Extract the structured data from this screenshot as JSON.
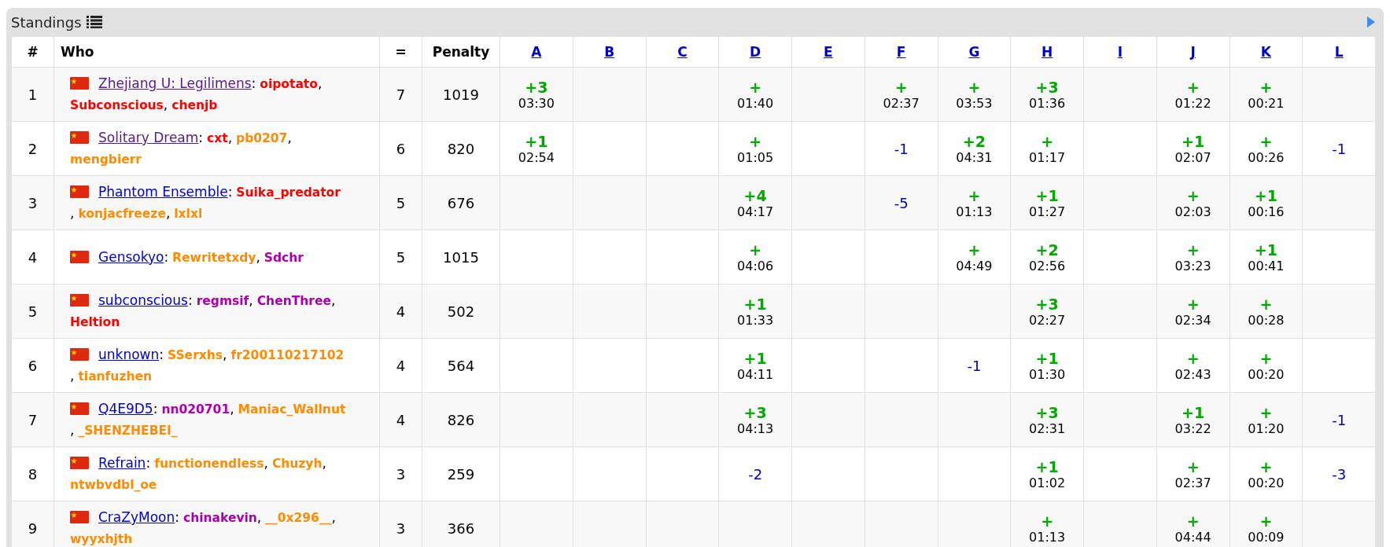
{
  "panel": {
    "title": "Standings"
  },
  "columns": {
    "rank": "#",
    "who": "Who",
    "solved": "=",
    "penalty": "Penalty",
    "problems": [
      "A",
      "B",
      "C",
      "D",
      "E",
      "F",
      "G",
      "H",
      "I",
      "J",
      "K",
      "L"
    ]
  },
  "rows": [
    {
      "rank": "1",
      "team": {
        "name": "Zhejiang U: Legilimens",
        "color": "#551a8b",
        "sep": ":"
      },
      "members": [
        {
          "name": "oipotato",
          "color": "#ff0000",
          "sep": ","
        },
        {
          "name": "Subconscious",
          "color": "#ff0000",
          "sep": ","
        },
        {
          "name": "chenjb",
          "color": "#ff0000"
        }
      ],
      "solved": "7",
      "penalty": "1019",
      "cells": [
        {
          "kind": "accepted",
          "score": "+3",
          "time": "03:30"
        },
        {
          "kind": "empty"
        },
        {
          "kind": "empty"
        },
        {
          "kind": "accepted",
          "score": "+",
          "time": "01:40"
        },
        {
          "kind": "empty"
        },
        {
          "kind": "accepted",
          "score": "+",
          "time": "02:37"
        },
        {
          "kind": "accepted",
          "score": "+",
          "time": "03:53"
        },
        {
          "kind": "accepted",
          "score": "+3",
          "time": "01:36"
        },
        {
          "kind": "empty"
        },
        {
          "kind": "accepted",
          "score": "+",
          "time": "01:22"
        },
        {
          "kind": "accepted",
          "score": "+",
          "time": "00:21"
        },
        {
          "kind": "empty"
        }
      ]
    },
    {
      "rank": "2",
      "team": {
        "name": "Solitary Dream",
        "color": "#551a8b",
        "sep": ":"
      },
      "members": [
        {
          "name": "cxt",
          "color": "#ff0000",
          "sep": ","
        },
        {
          "name": "pb0207",
          "color": "#ff8c00",
          "sep": ","
        },
        {
          "name": "mengbierr",
          "color": "#ff8c00"
        }
      ],
      "solved": "6",
      "penalty": "820",
      "cells": [
        {
          "kind": "accepted",
          "score": "+1",
          "time": "02:54"
        },
        {
          "kind": "empty"
        },
        {
          "kind": "empty"
        },
        {
          "kind": "accepted",
          "score": "+",
          "time": "01:05"
        },
        {
          "kind": "empty"
        },
        {
          "kind": "rejected",
          "score": "-1"
        },
        {
          "kind": "accepted",
          "score": "+2",
          "time": "04:31"
        },
        {
          "kind": "accepted",
          "score": "+",
          "time": "01:17"
        },
        {
          "kind": "empty"
        },
        {
          "kind": "accepted",
          "score": "+1",
          "time": "02:07"
        },
        {
          "kind": "accepted",
          "score": "+",
          "time": "00:26"
        },
        {
          "kind": "rejected",
          "score": "-1"
        }
      ]
    },
    {
      "rank": "3",
      "team": {
        "name": "Phantom Ensemble",
        "color": "#0000cc",
        "sep": ":"
      },
      "members": [
        {
          "name": "Suika_predator",
          "color": "#ff0000",
          "sep": ","
        },
        {
          "name": "konjacfreeze",
          "color": "#ff8c00",
          "sep": ","
        },
        {
          "name": "lxlxl",
          "color": "#ff8c00"
        }
      ],
      "solved": "5",
      "penalty": "676",
      "cells": [
        {
          "kind": "empty"
        },
        {
          "kind": "empty"
        },
        {
          "kind": "empty"
        },
        {
          "kind": "accepted",
          "score": "+4",
          "time": "04:17"
        },
        {
          "kind": "empty"
        },
        {
          "kind": "rejected",
          "score": "-5"
        },
        {
          "kind": "accepted",
          "score": "+",
          "time": "01:13"
        },
        {
          "kind": "accepted",
          "score": "+1",
          "time": "01:27"
        },
        {
          "kind": "empty"
        },
        {
          "kind": "accepted",
          "score": "+",
          "time": "02:03"
        },
        {
          "kind": "accepted",
          "score": "+1",
          "time": "00:16"
        },
        {
          "kind": "empty"
        }
      ]
    },
    {
      "rank": "4",
      "team": {
        "name": "Gensokyo",
        "color": "#0000cc",
        "sep": ":"
      },
      "members": [
        {
          "name": "Rewritetxdy",
          "color": "#ff8c00",
          "sep": ","
        },
        {
          "name": "Sdchr",
          "color": "#aa00aa"
        }
      ],
      "solved": "5",
      "penalty": "1015",
      "cells": [
        {
          "kind": "empty"
        },
        {
          "kind": "empty"
        },
        {
          "kind": "empty"
        },
        {
          "kind": "accepted",
          "score": "+",
          "time": "04:06"
        },
        {
          "kind": "empty"
        },
        {
          "kind": "empty"
        },
        {
          "kind": "accepted",
          "score": "+",
          "time": "04:49"
        },
        {
          "kind": "accepted",
          "score": "+2",
          "time": "02:56"
        },
        {
          "kind": "empty"
        },
        {
          "kind": "accepted",
          "score": "+",
          "time": "03:23"
        },
        {
          "kind": "accepted",
          "score": "+1",
          "time": "00:41"
        },
        {
          "kind": "empty"
        }
      ]
    },
    {
      "rank": "5",
      "team": {
        "name": "subconscious",
        "color": "#0000cc",
        "sep": ":"
      },
      "members": [
        {
          "name": "regmsif",
          "color": "#aa00aa",
          "sep": ","
        },
        {
          "name": "ChenThree",
          "color": "#aa00aa",
          "sep": ","
        },
        {
          "name": "Heltion",
          "color": "#ff0000"
        }
      ],
      "solved": "4",
      "penalty": "502",
      "cells": [
        {
          "kind": "empty"
        },
        {
          "kind": "empty"
        },
        {
          "kind": "empty"
        },
        {
          "kind": "accepted",
          "score": "+1",
          "time": "01:33"
        },
        {
          "kind": "empty"
        },
        {
          "kind": "empty"
        },
        {
          "kind": "empty"
        },
        {
          "kind": "accepted",
          "score": "+3",
          "time": "02:27"
        },
        {
          "kind": "empty"
        },
        {
          "kind": "accepted",
          "score": "+",
          "time": "02:34"
        },
        {
          "kind": "accepted",
          "score": "+",
          "time": "00:28"
        },
        {
          "kind": "empty"
        }
      ]
    },
    {
      "rank": "6",
      "team": {
        "name": "unknown",
        "color": "#0000cc",
        "sep": ":"
      },
      "members": [
        {
          "name": "SSerxhs",
          "color": "#ff8c00",
          "sep": ","
        },
        {
          "name": "fr200110217102",
          "color": "#ff8c00",
          "sep": ","
        },
        {
          "name": "tianfuzhen",
          "color": "#ff8c00"
        }
      ],
      "solved": "4",
      "penalty": "564",
      "cells": [
        {
          "kind": "empty"
        },
        {
          "kind": "empty"
        },
        {
          "kind": "empty"
        },
        {
          "kind": "accepted",
          "score": "+1",
          "time": "04:11"
        },
        {
          "kind": "empty"
        },
        {
          "kind": "empty"
        },
        {
          "kind": "rejected",
          "score": "-1"
        },
        {
          "kind": "accepted",
          "score": "+1",
          "time": "01:30"
        },
        {
          "kind": "empty"
        },
        {
          "kind": "accepted",
          "score": "+",
          "time": "02:43"
        },
        {
          "kind": "accepted",
          "score": "+",
          "time": "00:20"
        },
        {
          "kind": "empty"
        }
      ]
    },
    {
      "rank": "7",
      "team": {
        "name": "Q4E9D5",
        "color": "#0000cc",
        "sep": ":"
      },
      "members": [
        {
          "name": "nn020701",
          "color": "#aa00aa",
          "sep": ","
        },
        {
          "name": "Maniac_Wallnut",
          "color": "#ff8c00",
          "sep": ","
        },
        {
          "name": "_SHENZHEBEI_",
          "color": "#ff8c00"
        }
      ],
      "solved": "4",
      "penalty": "826",
      "cells": [
        {
          "kind": "empty"
        },
        {
          "kind": "empty"
        },
        {
          "kind": "empty"
        },
        {
          "kind": "accepted",
          "score": "+3",
          "time": "04:13"
        },
        {
          "kind": "empty"
        },
        {
          "kind": "empty"
        },
        {
          "kind": "empty"
        },
        {
          "kind": "accepted",
          "score": "+3",
          "time": "02:31"
        },
        {
          "kind": "empty"
        },
        {
          "kind": "accepted",
          "score": "+1",
          "time": "03:22"
        },
        {
          "kind": "accepted",
          "score": "+",
          "time": "01:20"
        },
        {
          "kind": "rejected",
          "score": "-1"
        }
      ]
    },
    {
      "rank": "8",
      "team": {
        "name": "Refrain",
        "color": "#0000cc",
        "sep": ":"
      },
      "members": [
        {
          "name": "functionendless",
          "color": "#ff8c00",
          "sep": ","
        },
        {
          "name": "Chuzyh",
          "color": "#ff8c00",
          "sep": ","
        },
        {
          "name": "ntwbvdbl_oe",
          "color": "#ff8c00"
        }
      ],
      "solved": "3",
      "penalty": "259",
      "cells": [
        {
          "kind": "empty"
        },
        {
          "kind": "empty"
        },
        {
          "kind": "empty"
        },
        {
          "kind": "rejected",
          "score": "-2"
        },
        {
          "kind": "empty"
        },
        {
          "kind": "empty"
        },
        {
          "kind": "empty"
        },
        {
          "kind": "accepted",
          "score": "+1",
          "time": "01:02"
        },
        {
          "kind": "empty"
        },
        {
          "kind": "accepted",
          "score": "+",
          "time": "02:37"
        },
        {
          "kind": "accepted",
          "score": "+",
          "time": "00:20"
        },
        {
          "kind": "rejected",
          "score": "-3"
        }
      ]
    },
    {
      "rank": "9",
      "team": {
        "name": "CraZyMoon",
        "color": "#0000cc",
        "sep": ":"
      },
      "members": [
        {
          "name": "chinakevin",
          "color": "#aa00aa",
          "sep": ","
        },
        {
          "name": "__0x296__",
          "color": "#ff8c00",
          "sep": ","
        },
        {
          "name": "wyyxhjth",
          "color": "#ff8c00"
        }
      ],
      "solved": "3",
      "penalty": "366",
      "cells": [
        {
          "kind": "empty"
        },
        {
          "kind": "empty"
        },
        {
          "kind": "empty"
        },
        {
          "kind": "empty"
        },
        {
          "kind": "empty"
        },
        {
          "kind": "empty"
        },
        {
          "kind": "empty"
        },
        {
          "kind": "accepted",
          "score": "+",
          "time": "01:13"
        },
        {
          "kind": "empty"
        },
        {
          "kind": "accepted",
          "score": "+",
          "time": "04:44"
        },
        {
          "kind": "accepted",
          "score": "+",
          "time": "00:09"
        },
        {
          "kind": "empty"
        }
      ]
    }
  ]
}
